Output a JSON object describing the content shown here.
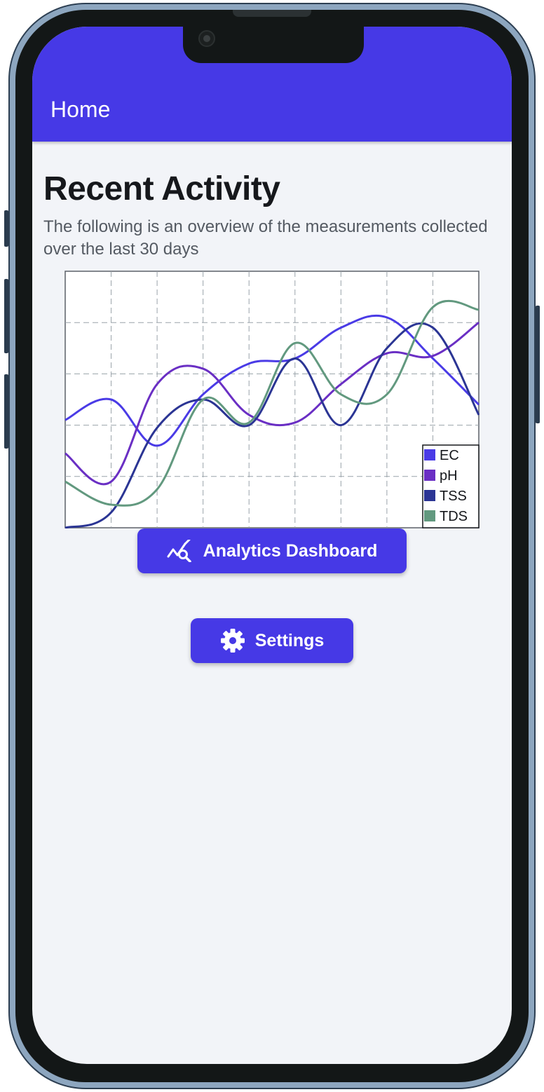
{
  "header": {
    "title": "Home"
  },
  "main": {
    "heading": "Recent Activity",
    "subtitle": "The following is an overview of the measurements collected over the last 30 days"
  },
  "buttons": {
    "analytics": {
      "label": "Analytics Dashboard",
      "icon": "analytics-icon"
    },
    "settings": {
      "label": "Settings",
      "icon": "gear-icon"
    }
  },
  "colors": {
    "accent": "#4639e6",
    "background": "#f2f4f8"
  },
  "chart_data": {
    "type": "line",
    "x": [
      0,
      1,
      2,
      3,
      4,
      5,
      6,
      7,
      8,
      9
    ],
    "xlim": [
      0,
      9
    ],
    "ylim": [
      0,
      5
    ],
    "grid": true,
    "legend_position": "bottom-right",
    "series": [
      {
        "name": "EC",
        "color": "#4a3be6",
        "values": [
          2.1,
          2.5,
          1.6,
          2.6,
          3.2,
          3.3,
          3.9,
          4.1,
          3.3,
          2.4
        ]
      },
      {
        "name": "pH",
        "color": "#6a2fc4",
        "values": [
          1.45,
          0.9,
          2.8,
          3.1,
          2.2,
          2.05,
          2.8,
          3.4,
          3.35,
          4.0
        ]
      },
      {
        "name": "TSS",
        "color": "#2b3594",
        "values": [
          0,
          0.3,
          1.95,
          2.5,
          2.0,
          3.3,
          2.0,
          3.5,
          3.9,
          2.2
        ]
      },
      {
        "name": "TDS",
        "color": "#62997f",
        "values": [
          0.9,
          0.45,
          0.75,
          2.5,
          2.05,
          3.6,
          2.6,
          2.6,
          4.3,
          4.25
        ]
      }
    ]
  }
}
